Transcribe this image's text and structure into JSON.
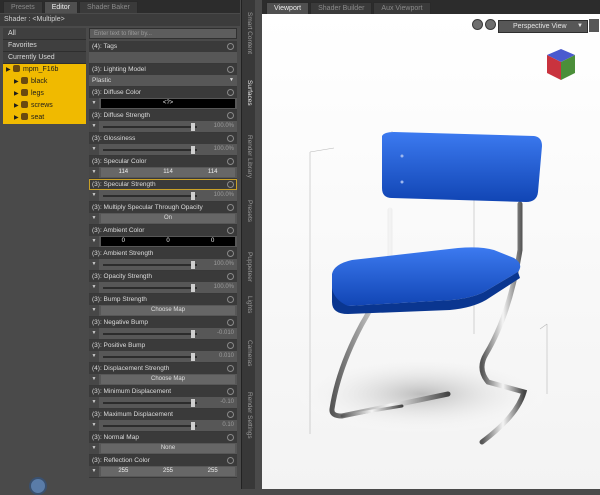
{
  "left_tabs": [
    "Presets",
    "Editor",
    "Shader Baker"
  ],
  "shader_line": "Shader : <Multiple>",
  "tree": [
    {
      "label": "All",
      "selected": false,
      "indent": 0
    },
    {
      "label": "Favorites",
      "selected": false,
      "indent": 0
    },
    {
      "label": "Currently Used",
      "selected": false,
      "indent": 0
    },
    {
      "label": "mpm_F16b",
      "selected": true,
      "indent": 0
    },
    {
      "label": "black",
      "selected": true,
      "indent": 1
    },
    {
      "label": "legs",
      "selected": true,
      "indent": 1
    },
    {
      "label": "screws",
      "selected": true,
      "indent": 1
    },
    {
      "label": "seat",
      "selected": true,
      "indent": 1
    }
  ],
  "filter_placeholder": "Enter text to filter by...",
  "properties": [
    {
      "label": "(4): Tags",
      "type": "text",
      "value": ""
    },
    {
      "label": "(3): Lighting Model",
      "type": "dropdown",
      "value": "Plastic"
    },
    {
      "label": "(3): Diffuse Color",
      "type": "color",
      "value": "<?>"
    },
    {
      "label": "(3): Diffuse Strength",
      "type": "slider",
      "value": "100.0%",
      "level": 0.98
    },
    {
      "label": "(3): Glossiness",
      "type": "slider",
      "value": "100.0%",
      "level": 0.98
    },
    {
      "label": "(3): Specular Color",
      "type": "rgb",
      "values": [
        "114",
        "114",
        "114"
      ]
    },
    {
      "label": "(3): Specular Strength",
      "type": "slider",
      "value": "100.0%",
      "level": 0.98,
      "highlight": true
    },
    {
      "label": "(3): Multiply Specular Through Opacity",
      "type": "button",
      "value": "On"
    },
    {
      "label": "(3): Ambient Color",
      "type": "rgb_dark",
      "values": [
        "0",
        "0",
        "0"
      ]
    },
    {
      "label": "(3): Ambient Strength",
      "type": "slider",
      "value": "100.0%",
      "level": 0.98
    },
    {
      "label": "(3): Opacity Strength",
      "type": "slider",
      "value": "100.0%",
      "level": 0.98
    },
    {
      "label": "(3): Bump Strength",
      "type": "button",
      "value": "Choose Map"
    },
    {
      "label": "(3): Negative Bump",
      "type": "slider",
      "value": "-0.010",
      "level": 0.98
    },
    {
      "label": "(3): Positive Bump",
      "type": "slider",
      "value": "0.010",
      "level": 0.98
    },
    {
      "label": "(4): Displacement Strength",
      "type": "button",
      "value": "Choose Map"
    },
    {
      "label": "(3): Minimum Displacement",
      "type": "slider",
      "value": "-0.10",
      "level": 0.98
    },
    {
      "label": "(3): Maximum Displacement",
      "type": "slider",
      "value": "0.10",
      "level": 0.98
    },
    {
      "label": "(3): Normal Map",
      "type": "button",
      "value": "None"
    },
    {
      "label": "(3): Reflection Color",
      "type": "rgb",
      "values": [
        "255",
        "255",
        "255"
      ]
    }
  ],
  "side_tabs": [
    "Smart Content",
    "Surfaces",
    "Render Library",
    "Presets",
    "Puppeteer",
    "Lights",
    "Cameras",
    "Render Settings"
  ],
  "viewport_tabs": [
    "Viewport",
    "Shader Builder",
    "Aux Viewport"
  ],
  "camera_label": "Perspective View",
  "colors": {
    "chair_blue": "#1f5fd6",
    "selection": "#f0ba00"
  }
}
